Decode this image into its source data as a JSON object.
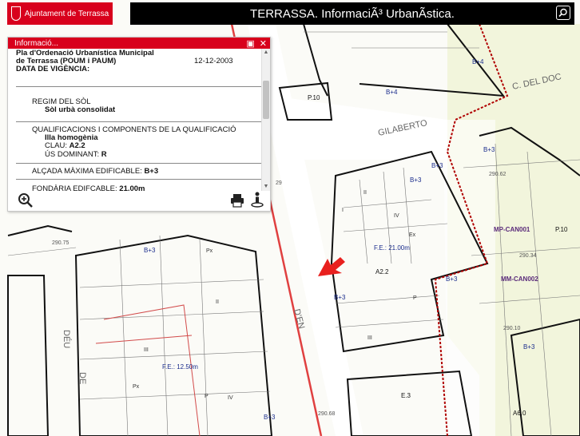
{
  "header": {
    "brand_text": "Ajuntament de Terrassa",
    "title": "TERRASSA. InformaciÃ³ UrbanÃstica."
  },
  "panel": {
    "title": "Informació...",
    "plan_line1": "Pla d'Ordenació Urbanística Municipal",
    "plan_line2": "de Terrassa (POUM i PAUM)",
    "plan_date": "12-12-2003",
    "validity_label": "DATA DE VIGÈNCIA:",
    "regime_label": "REGIM DEL SÒL",
    "regime_value": "Sòl urbà consolidat",
    "qual_label": "QUALIFICACIONS I COMPONENTS DE LA QUALIFICACIÓ",
    "qual_value": "Illa homogènia",
    "clau_label": "CLAU:",
    "clau_value": "A2.2",
    "us_label": "ÚS DOMINANT:",
    "us_value": "R",
    "height_label": "ALÇADA MÀXIMA EDIFICABLE:",
    "height_value": "B+3",
    "depth_label": "FONDÀRIA EDIFCABLE:",
    "depth_value": "21.00m"
  },
  "map_labels": {
    "p10_a": "P.10",
    "b4_a": "B+4",
    "b4_b": "B+4",
    "b3_a": "B+3",
    "b3_b": "B+3",
    "b3_c": "B+3",
    "b3_d": "B+3",
    "b3_e": "B+3",
    "b3_f": "B+3",
    "b3_g": "B+3",
    "b3_h": "B+3",
    "street_c_del_doc": "C. DEL DOC",
    "street_gilaberto": "GILABERTO",
    "street_deu": "DÉU",
    "street_de": "DE",
    "street_vertical": "D'EN",
    "h290_62": "290.62",
    "h290_34": "290.34",
    "h290_10": "290.10",
    "h290_75": "290.75",
    "h290_68": "290.68",
    "h290_29": "29",
    "mp_can001": "MP-CAN001",
    "mm_can002": "MM-CAN002",
    "p10_b": "P.10",
    "fe_21": "F.E.: 21.00m",
    "a22": "A2.2",
    "fe_12": "F.E.: 12.50m",
    "e3": "E.3",
    "a60": "A6.0",
    "px": "Px",
    "iv": "IV",
    "ex": "Ex",
    "iii": "III",
    "ii": "II",
    "p": "P",
    "i": "I"
  },
  "colors": {
    "brand_red": "#d8001c",
    "panel_header_red": "#d8001c",
    "topbar_black": "#000000",
    "map_blue_label": "#1a2c8c",
    "zone_purple": "#5a2a7a",
    "boundary_red": "#c81414",
    "green_zone": "#f2f5dc"
  },
  "icons": {
    "zoom": "zoom-in-icon",
    "print": "print-icon",
    "info": "info-person-icon",
    "search": "search-icon",
    "arrow": "location-arrow-icon",
    "crest": "crest-icon",
    "minimize": "minimize-icon",
    "close": "close-icon"
  }
}
